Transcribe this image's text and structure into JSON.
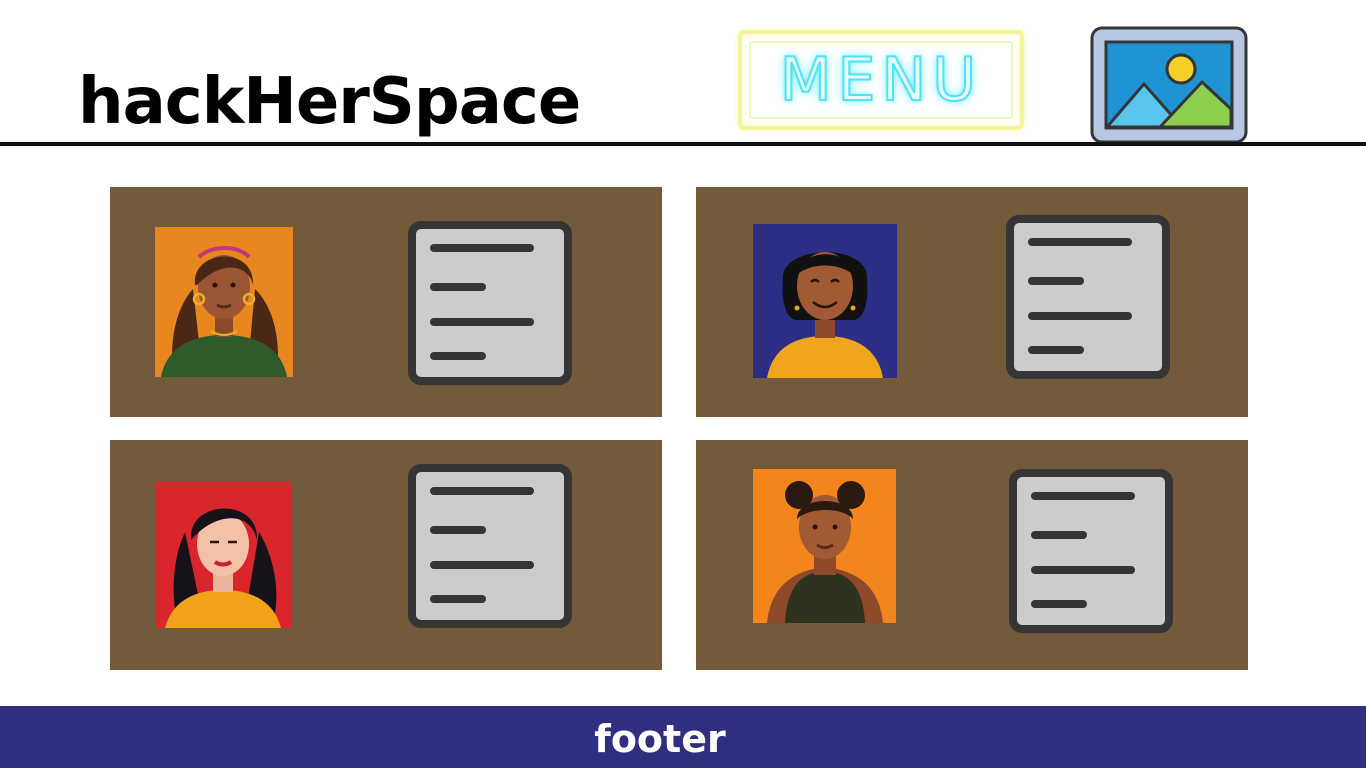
{
  "header": {
    "site_title": "hackHerSpace"
  },
  "menu": {
    "label": "MENU"
  },
  "profiles": [
    {
      "avatar_bg": "#e8861f"
    },
    {
      "avatar_bg": "#2c2d85"
    },
    {
      "avatar_bg": "#d9262c"
    },
    {
      "avatar_bg": "#f2851b"
    }
  ],
  "footer": {
    "label": "footer"
  },
  "colors": {
    "card": "#735a3a",
    "footer": "#2f2e7f",
    "neon_blue": "#4fe3f4",
    "neon_yellow": "#f3f39a"
  }
}
